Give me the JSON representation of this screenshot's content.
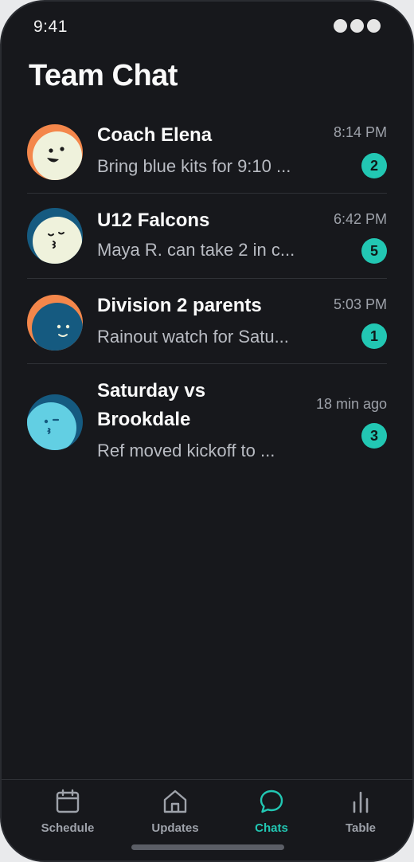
{
  "status_bar": {
    "time": "9:41"
  },
  "header": {
    "title": "Team Chat"
  },
  "chats": [
    {
      "name": "Coach Elena",
      "preview": "Bring blue kits for 9:10 ...",
      "timestamp": "8:14 PM",
      "unread": "2",
      "avatar_icon": "smiling-face-avatar-icon"
    },
    {
      "name": "U12 Falcons",
      "preview": "Maya R. can take 2 in c...",
      "timestamp": "6:42 PM",
      "unread": "5",
      "avatar_icon": "kissing-face-avatar-icon"
    },
    {
      "name": "Division 2 parents",
      "preview": "Rainout watch for Satu...",
      "timestamp": "5:03 PM",
      "unread": "1",
      "avatar_icon": "shy-face-avatar-icon"
    },
    {
      "name": "Saturday vs Brookdale",
      "preview": "Ref moved kickoff to ...",
      "timestamp": "18 min ago",
      "unread": "3",
      "avatar_icon": "winking-face-avatar-icon"
    }
  ],
  "tabs": [
    {
      "label": "Schedule",
      "icon": "calendar-icon",
      "active": false
    },
    {
      "label": "Updates",
      "icon": "home-icon",
      "active": false
    },
    {
      "label": "Chats",
      "icon": "chat-bubble-icon",
      "active": true
    },
    {
      "label": "Table",
      "icon": "bar-chart-icon",
      "active": false
    }
  ],
  "colors": {
    "background": "#17181c",
    "accent": "#22c7b3",
    "orange": "#f4874b",
    "navy": "#155a80",
    "cream": "#eff2dc",
    "sky": "#62cfe3"
  }
}
